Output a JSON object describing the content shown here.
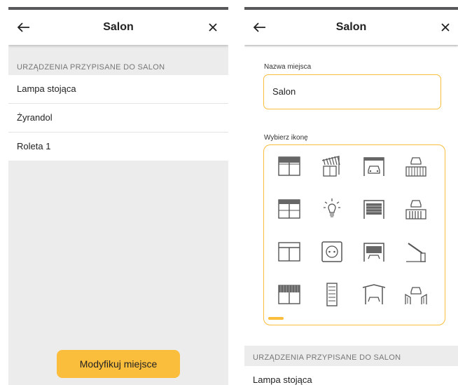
{
  "left_screen": {
    "header": {
      "title": "Salon",
      "back_icon": "arrow-left-icon",
      "close_icon": "close-icon"
    },
    "section_label": "URZĄDZENIA PRZYPISANE DO SALON",
    "devices": [
      {
        "label": "Lampa stojąca"
      },
      {
        "label": "Żyrandol"
      },
      {
        "label": "Roleta 1"
      }
    ],
    "modify_button": "Modyfikuj miejsce"
  },
  "right_screen": {
    "header": {
      "title": "Salon",
      "back_icon": "arrow-left-icon",
      "close_icon": "close-icon"
    },
    "name_label": "Nazwa miejsca",
    "name_value": "Salon",
    "icon_label": "Wybierz ikonę",
    "icons": [
      "window-blinds-icon",
      "awning-icon",
      "garage-car-icon",
      "car-fence-icon",
      "window-shutter-icon",
      "lightbulb-icon",
      "garage-door-icon",
      "car-gate-icon",
      "window-icon",
      "socket-icon",
      "garage-shutter-icon",
      "barrier-gate-icon",
      "window-roller-icon",
      "panel-icon",
      "carport-icon",
      "car-swing-gate-icon"
    ],
    "section_label": "URZĄDZENIA PRZYPISANE DO SALON",
    "devices": [
      {
        "label": "Lampa stojąca"
      }
    ]
  },
  "colors": {
    "accent": "#fbbd3c",
    "background": "#ececec",
    "header_bar": "#58585a"
  }
}
